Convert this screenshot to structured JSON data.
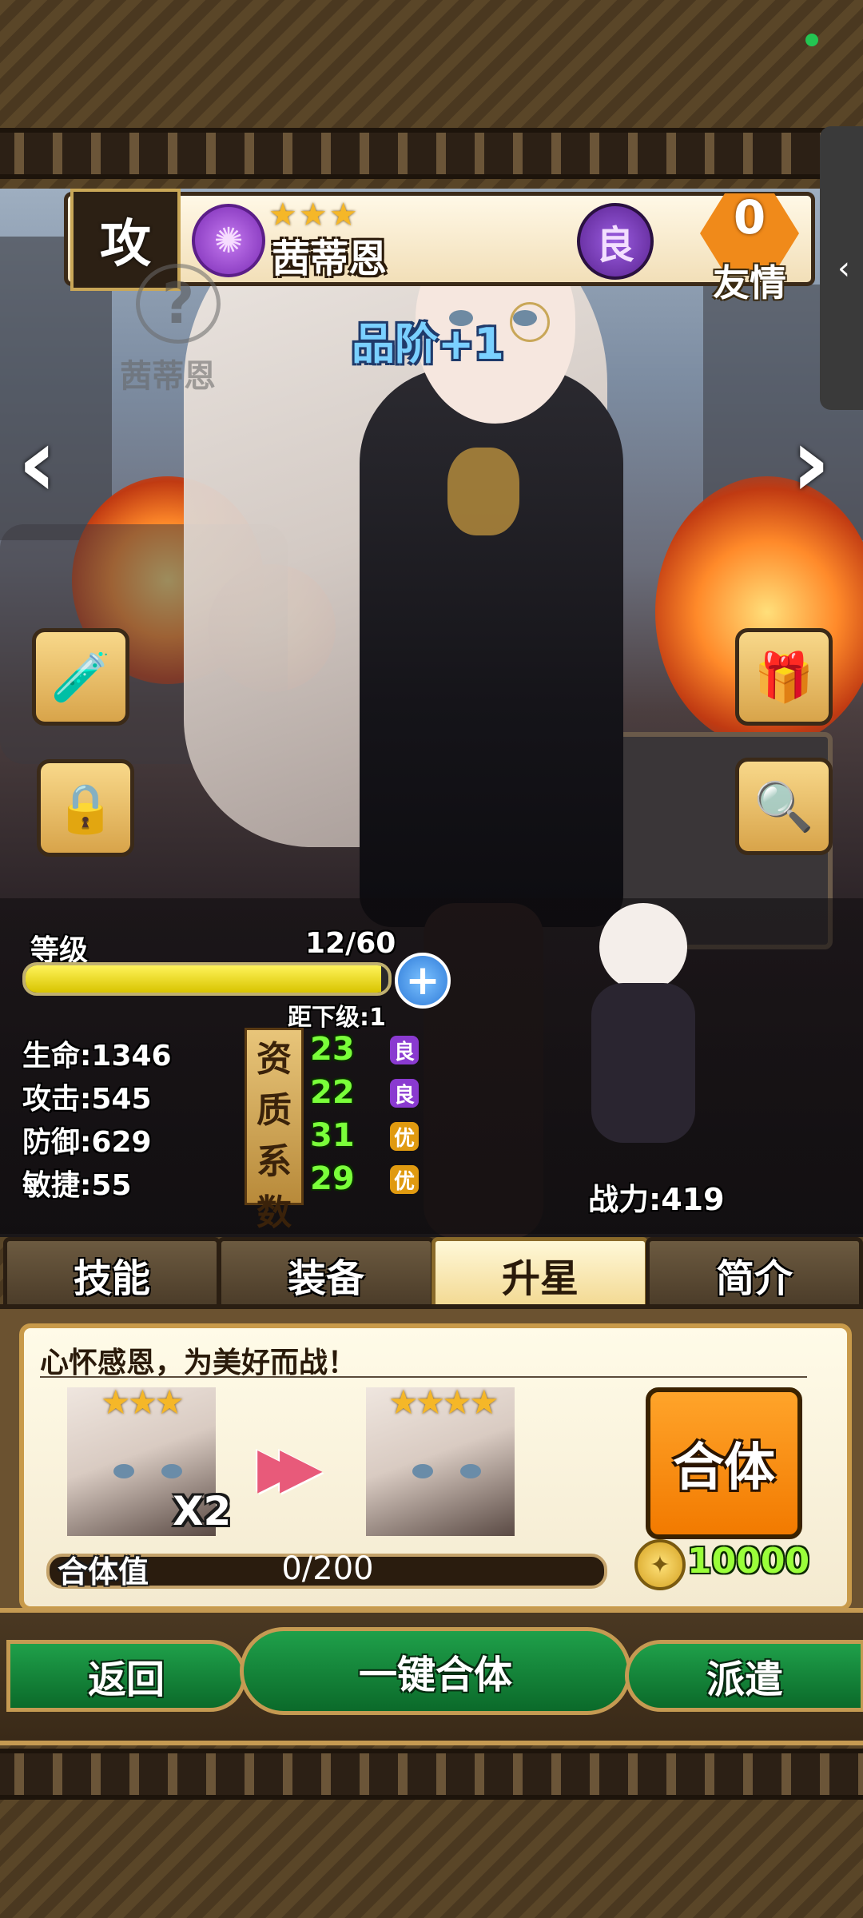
{
  "status": {
    "indicator_color": "#23c552"
  },
  "side_tab": {
    "icon": "chevron-left-icon",
    "glyph": "‹"
  },
  "hero": {
    "class_label": "攻",
    "element_icon": "swirl-icon",
    "element_glyph": "✺",
    "stars": "★★★",
    "name": "茜蒂恩",
    "quality": "良",
    "friendship_value": "0",
    "friendship_label": "友情",
    "mini_portrait_name": "茜蒂恩",
    "mini_portrait_mark": "?",
    "grade_text": "品阶+1"
  },
  "nav_arrows": {
    "left": "‹",
    "right": "›"
  },
  "side_buttons": [
    {
      "name": "potion-button",
      "icon": "potion-icon",
      "glyph": "🧪"
    },
    {
      "name": "lock-button",
      "icon": "lock-icon",
      "glyph": "🔒"
    },
    {
      "name": "gift-button",
      "icon": "gift-icon",
      "glyph": "🎁"
    },
    {
      "name": "magnifier-button",
      "icon": "magnifier-icon",
      "glyph": "🔍"
    }
  ],
  "level": {
    "label": "等级",
    "text": "12/60",
    "current": 12,
    "max": 60,
    "next_label": "距下级:1",
    "bar_fill_fraction": 0.98
  },
  "stats": [
    {
      "label": "生命:1346"
    },
    {
      "label": "攻击:545"
    },
    {
      "label": "防御:629"
    },
    {
      "label": "敏捷:55"
    }
  ],
  "aptitude": {
    "chars": [
      "资",
      "质",
      "系",
      "数"
    ],
    "rows": [
      {
        "value": "23",
        "rank": "良",
        "rank_color": "#8a3ad0"
      },
      {
        "value": "22",
        "rank": "良",
        "rank_color": "#8a3ad0"
      },
      {
        "value": "31",
        "rank": "优",
        "rank_color": "#e09a10"
      },
      {
        "value": "29",
        "rank": "优",
        "rank_color": "#e09a10"
      }
    ]
  },
  "power": {
    "label": "战力:419"
  },
  "tabs": [
    {
      "label": "技能",
      "active": false
    },
    {
      "label": "装备",
      "active": false
    },
    {
      "label": "升星",
      "active": true
    },
    {
      "label": "简介",
      "active": false
    }
  ],
  "star_up": {
    "quote": "心怀感恩，为美好而战！",
    "from_stars": "★★★",
    "to_stars": "★★★★",
    "multiplier": "X2",
    "merge_button": "合体",
    "merge_label": "合体值",
    "merge_value": "0/200",
    "merge_fraction": 0,
    "cost": "10000",
    "coin_icon": "coin-icon"
  },
  "bottom": {
    "back": "返回",
    "one_click": "一键合体",
    "dispatch": "派遣"
  },
  "colors": {
    "accent_orange": "#f27a00",
    "bar_yellow": "#fff35a",
    "green_text": "#7aff3a",
    "green_button": "#0b6a2a"
  }
}
